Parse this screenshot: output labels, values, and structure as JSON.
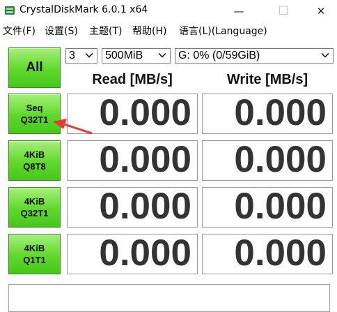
{
  "window": {
    "title": "CrystalDiskMark 6.0.1 x64",
    "minimize_glyph": "—",
    "maximize_glyph": "☐",
    "close_glyph": "✕"
  },
  "menu": {
    "items": [
      "文件(F)",
      "设置(S)",
      "主题(T)",
      "帮助(H)",
      "语言(L)(Language)"
    ]
  },
  "controls": {
    "all_label": "All",
    "count_value": "3",
    "size_value": "500MiB",
    "drive_value": "G: 0% (0/59GiB)"
  },
  "headers": {
    "read": "Read [MB/s]",
    "write": "Write [MB/s]"
  },
  "tests": [
    {
      "line1": "Seq",
      "line2": "Q32T1",
      "read": "0.000",
      "write": "0.000"
    },
    {
      "line1": "4KiB",
      "line2": "Q8T8",
      "read": "0.000",
      "write": "0.000"
    },
    {
      "line1": "4KiB",
      "line2": "Q32T1",
      "read": "0.000",
      "write": "0.000"
    },
    {
      "line1": "4KiB",
      "line2": "Q1T1",
      "read": "0.000",
      "write": "0.000"
    }
  ],
  "comment": "",
  "colors": {
    "button_green": "#5fd82b",
    "annotation_arrow": "#e53935"
  },
  "icons": {
    "app": "crystaldiskmark-app-icon",
    "dropdown": "chevron-down-icon"
  }
}
